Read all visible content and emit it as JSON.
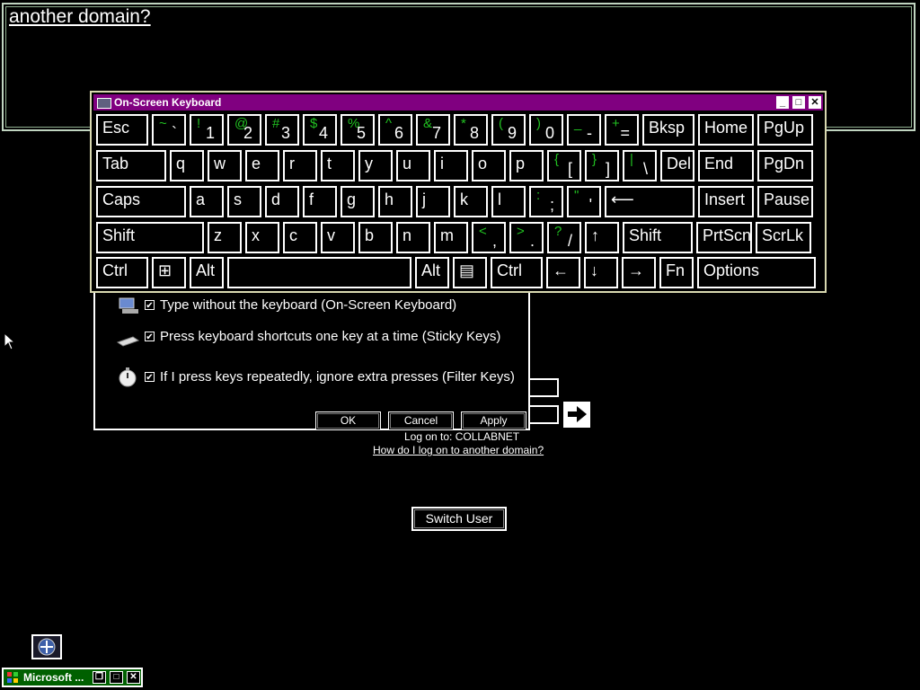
{
  "help_box": {
    "link_text": "another domain?"
  },
  "dialog": {
    "options": [
      {
        "label": "Type without the keyboard (On-Screen Keyboard)",
        "checked": true,
        "icon": "monitor-keyboard-icon"
      },
      {
        "label": "Press keyboard shortcuts one key at a time (Sticky Keys)",
        "checked": true,
        "icon": "sticky-keys-icon"
      },
      {
        "label": "If I press keys repeatedly, ignore extra presses (Filter Keys)",
        "checked": true,
        "icon": "stopwatch-icon"
      }
    ],
    "buttons": {
      "ok": "OK",
      "cancel": "Cancel",
      "apply": "Apply"
    }
  },
  "login": {
    "logon_to": "Log on to: COLLABNET",
    "domain_link": "How do I log on to another domain?",
    "switch_user": "Switch User",
    "submit_arrow": "🡆"
  },
  "osk": {
    "title": "On-Screen Keyboard",
    "controls": {
      "minimize": "_",
      "restore": "□",
      "close": "✕"
    },
    "rows": [
      [
        {
          "label": "Esc"
        },
        {
          "shift": "~",
          "base": "`"
        },
        {
          "shift": "!",
          "base": "1"
        },
        {
          "shift": "@",
          "base": "2"
        },
        {
          "shift": "#",
          "base": "3"
        },
        {
          "shift": "$",
          "base": "4"
        },
        {
          "shift": "%",
          "base": "5"
        },
        {
          "shift": "^",
          "base": "6"
        },
        {
          "shift": "&",
          "base": "7"
        },
        {
          "shift": "*",
          "base": "8"
        },
        {
          "shift": "(",
          "base": "9"
        },
        {
          "shift": ")",
          "base": "0"
        },
        {
          "shift": "_",
          "base": "-"
        },
        {
          "shift": "+",
          "base": "="
        },
        {
          "label": "Bksp"
        },
        {
          "label": "Home"
        },
        {
          "label": "PgUp"
        }
      ],
      [
        {
          "label": "Tab"
        },
        {
          "label": "q"
        },
        {
          "label": "w"
        },
        {
          "label": "e"
        },
        {
          "label": "r"
        },
        {
          "label": "t"
        },
        {
          "label": "y"
        },
        {
          "label": "u"
        },
        {
          "label": "i"
        },
        {
          "label": "o"
        },
        {
          "label": "p"
        },
        {
          "shift": "{",
          "base": "["
        },
        {
          "shift": "}",
          "base": "]"
        },
        {
          "shift": "|",
          "base": "\\"
        },
        {
          "label": "Del"
        },
        {
          "label": "End"
        },
        {
          "label": "PgDn"
        }
      ],
      [
        {
          "label": "Caps"
        },
        {
          "label": "a"
        },
        {
          "label": "s"
        },
        {
          "label": "d"
        },
        {
          "label": "f"
        },
        {
          "label": "g"
        },
        {
          "label": "h"
        },
        {
          "label": "j"
        },
        {
          "label": "k"
        },
        {
          "label": "l"
        },
        {
          "shift": ":",
          "base": ";"
        },
        {
          "shift": "\"",
          "base": "'"
        },
        {
          "label": "⟵"
        },
        {
          "label": "Insert"
        },
        {
          "label": "Pause"
        }
      ],
      [
        {
          "label": "Shift"
        },
        {
          "label": "z"
        },
        {
          "label": "x"
        },
        {
          "label": "c"
        },
        {
          "label": "v"
        },
        {
          "label": "b"
        },
        {
          "label": "n"
        },
        {
          "label": "m"
        },
        {
          "shift": "<",
          "base": ","
        },
        {
          "shift": ">",
          "base": "."
        },
        {
          "shift": "?",
          "base": "/"
        },
        {
          "label": "↑"
        },
        {
          "label": "Shift"
        },
        {
          "label": "PrtScn"
        },
        {
          "label": "ScrLk"
        }
      ],
      [
        {
          "label": "Ctrl"
        },
        {
          "label": "⊞"
        },
        {
          "label": "Alt"
        },
        {
          "label": ""
        },
        {
          "label": "Alt"
        },
        {
          "label": "▤"
        },
        {
          "label": "Ctrl"
        },
        {
          "label": "←"
        },
        {
          "label": "↓"
        },
        {
          "label": "→"
        },
        {
          "label": "Fn"
        },
        {
          "label": "Options"
        }
      ]
    ]
  },
  "taskbar": {
    "label": "Microsoft ...",
    "controls": {
      "restore": "❐",
      "maximize": "□",
      "close": "✕"
    }
  }
}
